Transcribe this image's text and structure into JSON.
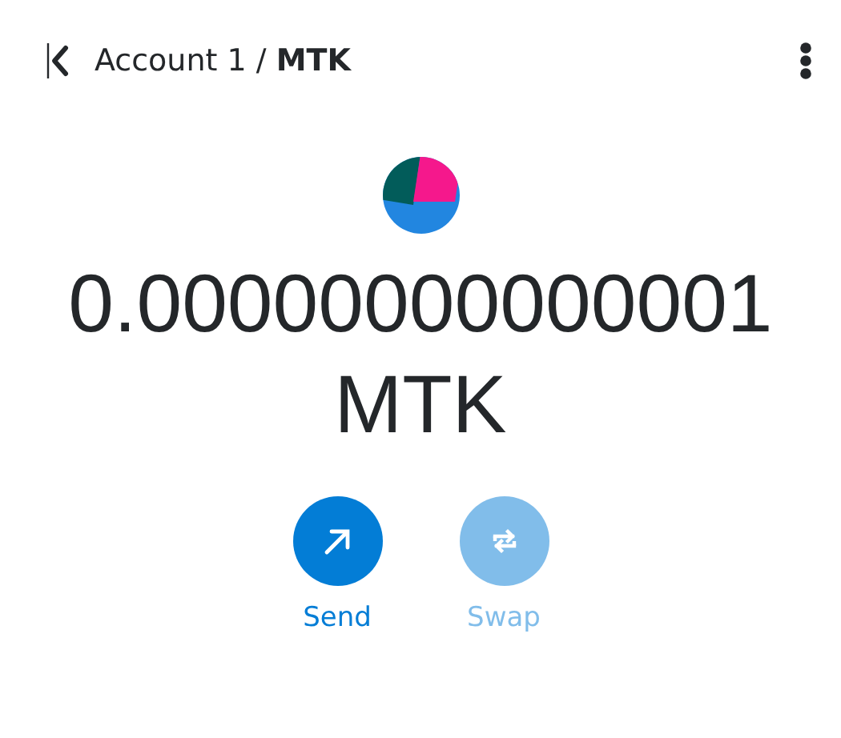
{
  "header": {
    "breadcrumb": "Account 1 / **MTK**"
  },
  "balance": {
    "amount": "0.00000000000001",
    "symbol": "MTK"
  },
  "actions": [
    {
      "kind": "send",
      "label": "Send",
      "disabled": false
    },
    {
      "kind": "swap",
      "label": "Swap",
      "disabled": true
    }
  ]
}
